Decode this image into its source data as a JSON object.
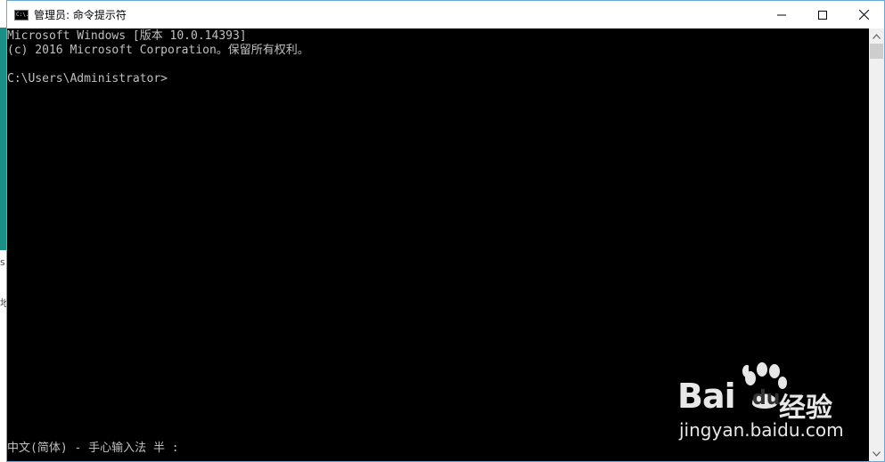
{
  "window": {
    "title": "管理员: 命令提示符",
    "icon": "console-app-icon",
    "icon_text": "C:\\."
  },
  "controls": {
    "minimize_icon": "minimize-icon",
    "maximize_icon": "maximize-icon",
    "close_icon": "close-icon"
  },
  "console": {
    "lines": [
      "Microsoft Windows [版本 10.0.14393]",
      "(c) 2016 Microsoft Corporation。保留所有权利。",
      "C:\\Users\\Administrator>"
    ],
    "ime_status": "中文(简体) - 手心输入法 半 :",
    "background": "#000000",
    "foreground": "#c0c0c0"
  },
  "desktop": {
    "glyph_1": "s",
    "glyph_2": "地"
  },
  "watermark": {
    "logo_text": "Bai",
    "logo_text_2": "du",
    "brand": "经验",
    "url": "jingyan.baidu.com"
  }
}
